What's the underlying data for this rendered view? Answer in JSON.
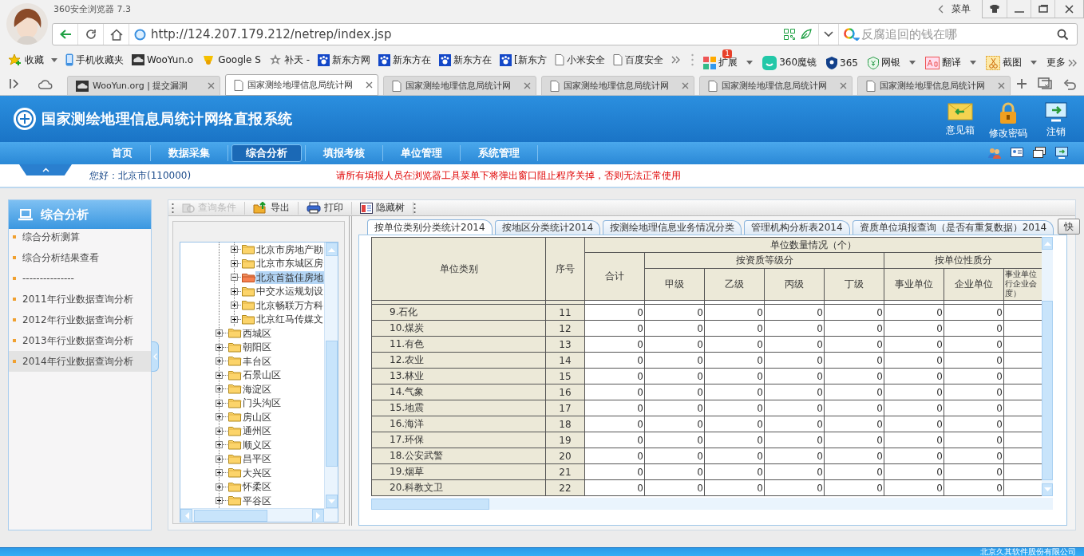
{
  "browser": {
    "title": "360安全浏览器 7.3",
    "menu_label": "菜单",
    "url": "http://124.207.179.212/netrep/index.jsp",
    "search_placeholder": "反腐追回的钱在哪",
    "bookmarks": [
      {
        "label": "收藏",
        "kind": "favorites",
        "dropdown": true
      },
      {
        "label": "手机收藏夹",
        "kind": "mobile",
        "dropdown": false
      },
      {
        "label": "WooYun.o",
        "kind": "site",
        "dropdown": false
      },
      {
        "label": "Google S",
        "kind": "bell",
        "dropdown": false
      },
      {
        "label": "补天 -",
        "kind": "star",
        "dropdown": false
      },
      {
        "label": "新东方网",
        "kind": "paw",
        "dropdown": false
      },
      {
        "label": "新东方在",
        "kind": "paw",
        "dropdown": false
      },
      {
        "label": "新东方在",
        "kind": "paw",
        "dropdown": false
      },
      {
        "label": "[新东方",
        "kind": "paw",
        "dropdown": false
      },
      {
        "label": "小米安全",
        "kind": "page",
        "dropdown": false
      },
      {
        "label": "百度安全",
        "kind": "page",
        "dropdown": false
      }
    ],
    "tools": [
      {
        "label": "扩展",
        "kind": "apps",
        "badge": "1",
        "dropdown": true
      },
      {
        "label": "360魔镜",
        "kind": "mirror",
        "dropdown": false
      },
      {
        "label": "365",
        "kind": "shield",
        "dropdown": false
      },
      {
        "label": "网银",
        "kind": "bank",
        "dropdown": true
      },
      {
        "label": "翻译",
        "kind": "translate",
        "dropdown": true
      },
      {
        "label": "截图",
        "kind": "scissors",
        "dropdown": true
      },
      {
        "label": "更多",
        "kind": "more",
        "dropdown": false
      }
    ],
    "tabs": [
      {
        "label": "WooYun.org | 提交漏洞",
        "kind": "site",
        "selected": false
      },
      {
        "label": "国家测绘地理信息局统计网",
        "kind": "page",
        "selected": true
      },
      {
        "label": "国家测绘地理信息局统计网",
        "kind": "page",
        "selected": false
      },
      {
        "label": "国家测绘地理信息局统计网",
        "kind": "page",
        "selected": false
      },
      {
        "label": "国家测绘地理信息局统计网",
        "kind": "page",
        "selected": false
      },
      {
        "label": "国家测绘地理信息局统计网",
        "kind": "page",
        "selected": false
      }
    ]
  },
  "header": {
    "title": "国家测绘地理信息局统计网络直报系统",
    "actions": [
      {
        "label": "意见箱",
        "kind": "mail"
      },
      {
        "label": "修改密码",
        "kind": "lock"
      },
      {
        "label": "注销",
        "kind": "logout"
      }
    ]
  },
  "nav": [
    {
      "label": "首页",
      "selected": false
    },
    {
      "label": "数据采集",
      "selected": false
    },
    {
      "label": "综合分析",
      "selected": true
    },
    {
      "label": "填报考核",
      "selected": false
    },
    {
      "label": "单位管理",
      "selected": false
    },
    {
      "label": "系统管理",
      "selected": false
    }
  ],
  "info": {
    "greeting": "您好：北京市(110000)",
    "notice": "请所有填报人员在浏览器工具菜单下将弹出窗口阻止程序关掉，否则无法正常使用"
  },
  "sidebar": {
    "title": "综合分析",
    "items": [
      {
        "label": "综合分析测算",
        "selected": false
      },
      {
        "label": "综合分析结果查看",
        "selected": false
      },
      {
        "label": "---------------",
        "selected": false
      },
      {
        "label": "2011年行业数据查询分析",
        "selected": false
      },
      {
        "label": "2012年行业数据查询分析",
        "selected": false
      },
      {
        "label": "2013年行业数据查询分析",
        "selected": false
      },
      {
        "label": "2014年行业数据查询分析",
        "selected": true
      }
    ]
  },
  "toolbar": [
    {
      "label": "查询条件",
      "kind": "query",
      "disabled": true
    },
    {
      "label": "导出",
      "kind": "export",
      "disabled": false
    },
    {
      "label": "打印",
      "kind": "print",
      "disabled": false
    },
    {
      "label": "隐藏树",
      "kind": "tree",
      "disabled": false
    }
  ],
  "tree": {
    "continued_children": [
      {
        "label": "北京市房地产勘",
        "expanded": false,
        "selected": false
      },
      {
        "label": "北京市东城区房",
        "expanded": false,
        "selected": false
      },
      {
        "label": "北京首益佳房地",
        "expanded": true,
        "selected": true
      },
      {
        "label": "中交水运规划设",
        "expanded": false,
        "selected": false
      },
      {
        "label": "北京畅联万方科",
        "expanded": false,
        "selected": false
      },
      {
        "label": "北京红马传媒文",
        "expanded": false,
        "selected": false
      }
    ],
    "items": [
      {
        "label": "西城区",
        "expanded": false,
        "selected": false
      },
      {
        "label": "朝阳区",
        "expanded": false,
        "selected": false
      },
      {
        "label": "丰台区",
        "expanded": false,
        "selected": false
      },
      {
        "label": "石景山区",
        "expanded": false,
        "selected": false
      },
      {
        "label": "海淀区",
        "expanded": false,
        "selected": false
      },
      {
        "label": "门头沟区",
        "expanded": false,
        "selected": false
      },
      {
        "label": "房山区",
        "expanded": false,
        "selected": false
      },
      {
        "label": "通州区",
        "expanded": false,
        "selected": false
      },
      {
        "label": "顺义区",
        "expanded": false,
        "selected": false
      },
      {
        "label": "昌平区",
        "expanded": false,
        "selected": false
      },
      {
        "label": "大兴区",
        "expanded": false,
        "selected": false
      },
      {
        "label": "怀柔区",
        "expanded": false,
        "selected": false
      },
      {
        "label": "平谷区",
        "expanded": false,
        "selected": false
      }
    ]
  },
  "report": {
    "tabs": [
      {
        "label": "按单位类别分类统计2014",
        "selected": true
      },
      {
        "label": "按地区分类统计2014",
        "selected": false
      },
      {
        "label": "按测绘地理信息业务情况分类",
        "selected": false
      },
      {
        "label": "管理机构分析表2014",
        "selected": false
      },
      {
        "label": "资质单位填报查询（是否有重复数据）2014",
        "selected": false
      }
    ],
    "more_button": "快",
    "header": {
      "category": "单位类别",
      "index": "序号",
      "group": "单位数量情况（个）",
      "total": "合计",
      "grade_group": "按资质等级分",
      "grades": [
        "甲级",
        "乙级",
        "丙级",
        "丁级"
      ],
      "nature_group": "按单位性质分",
      "natures": [
        "事业单位",
        "企业单位",
        "事业单位行企业会度）"
      ]
    },
    "rows": [
      {
        "category": "9.石化",
        "index": "11",
        "values": [
          "0",
          "0",
          "0",
          "0",
          "0",
          "0",
          "0"
        ]
      },
      {
        "category": "10.煤炭",
        "index": "12",
        "values": [
          "0",
          "0",
          "0",
          "0",
          "0",
          "0",
          "0"
        ]
      },
      {
        "category": "11.有色",
        "index": "13",
        "values": [
          "0",
          "0",
          "0",
          "0",
          "0",
          "0",
          "0"
        ]
      },
      {
        "category": "12.农业",
        "index": "14",
        "values": [
          "0",
          "0",
          "0",
          "0",
          "0",
          "0",
          "0"
        ]
      },
      {
        "category": "13.林业",
        "index": "15",
        "values": [
          "0",
          "0",
          "0",
          "0",
          "0",
          "0",
          "0"
        ]
      },
      {
        "category": "14.气象",
        "index": "16",
        "values": [
          "0",
          "0",
          "0",
          "0",
          "0",
          "0",
          "0"
        ]
      },
      {
        "category": "15.地震",
        "index": "17",
        "values": [
          "0",
          "0",
          "0",
          "0",
          "0",
          "0",
          "0"
        ]
      },
      {
        "category": "16.海洋",
        "index": "18",
        "values": [
          "0",
          "0",
          "0",
          "0",
          "0",
          "0",
          "0"
        ]
      },
      {
        "category": "17.环保",
        "index": "19",
        "values": [
          "0",
          "0",
          "0",
          "0",
          "0",
          "0",
          "0"
        ]
      },
      {
        "category": "18.公安武警",
        "index": "20",
        "values": [
          "0",
          "0",
          "0",
          "0",
          "0",
          "0",
          "0"
        ]
      },
      {
        "category": "19.烟草",
        "index": "21",
        "values": [
          "0",
          "0",
          "0",
          "0",
          "0",
          "0",
          "0"
        ]
      },
      {
        "category": "20.科教文卫",
        "index": "22",
        "values": [
          "0",
          "0",
          "0",
          "0",
          "0",
          "0",
          "0"
        ]
      }
    ]
  },
  "footer": "北京久其软件股份有限公司"
}
